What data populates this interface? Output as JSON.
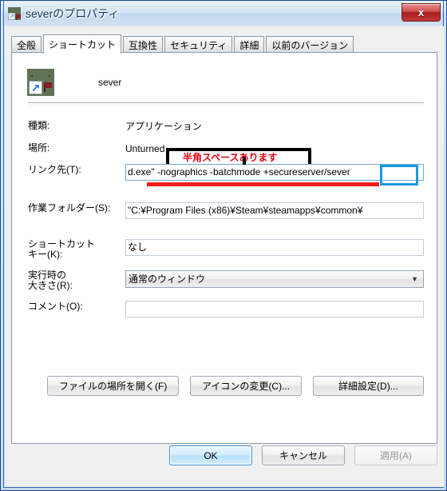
{
  "window": {
    "title": "severのプロパティ",
    "title_icon": "shortcut-app-icon",
    "close_label": "x"
  },
  "tabs": [
    {
      "label": "全般",
      "selected": false
    },
    {
      "label": "ショートカット",
      "selected": true
    },
    {
      "label": "互換性",
      "selected": false
    },
    {
      "label": "セキュリティ",
      "selected": false
    },
    {
      "label": "詳細",
      "selected": false
    },
    {
      "label": "以前のバージョン",
      "selected": false
    }
  ],
  "header": {
    "app_name": "sever",
    "icon": "shortcut-app-icon"
  },
  "fields": {
    "type": {
      "label": "種類:",
      "value": "アプリケーション"
    },
    "location": {
      "label": "場所:",
      "value": "Unturned"
    },
    "target": {
      "label": "リンク先(T):",
      "value": "d.exe\" -nographics -batchmode +secureserver/sever",
      "focused": true
    },
    "workdir": {
      "label": "作業フォルダー(S):",
      "value": "\"C:¥Program Files (x86)¥Steam¥steamapps¥common¥"
    },
    "hotkey": {
      "label_line1": "ショートカット",
      "label_line2": "キー(K):",
      "value": "なし"
    },
    "runsize": {
      "label_line1": "実行時の",
      "label_line2": "大きさ(R):",
      "value": "通常のウィンドウ",
      "caret": "▼"
    },
    "comment": {
      "label": "コメント(O):",
      "value": ""
    }
  },
  "mid_buttons": {
    "open_location": "ファイルの場所を開く(F)",
    "change_icon": "アイコンの変更(C)...",
    "advanced": "詳細設定(D)..."
  },
  "bottom_buttons": {
    "ok": "OK",
    "cancel": "キャンセル",
    "apply": "適用(A)"
  },
  "annotations": {
    "space_note": "半角スペースあります"
  },
  "colors": {
    "annotation_red": "#e8000d",
    "underline_red": "#f41c1c",
    "highlight_blue": "#1b9ae0",
    "window_border": "#1a4b8c",
    "close_button": "#a81c1c"
  }
}
